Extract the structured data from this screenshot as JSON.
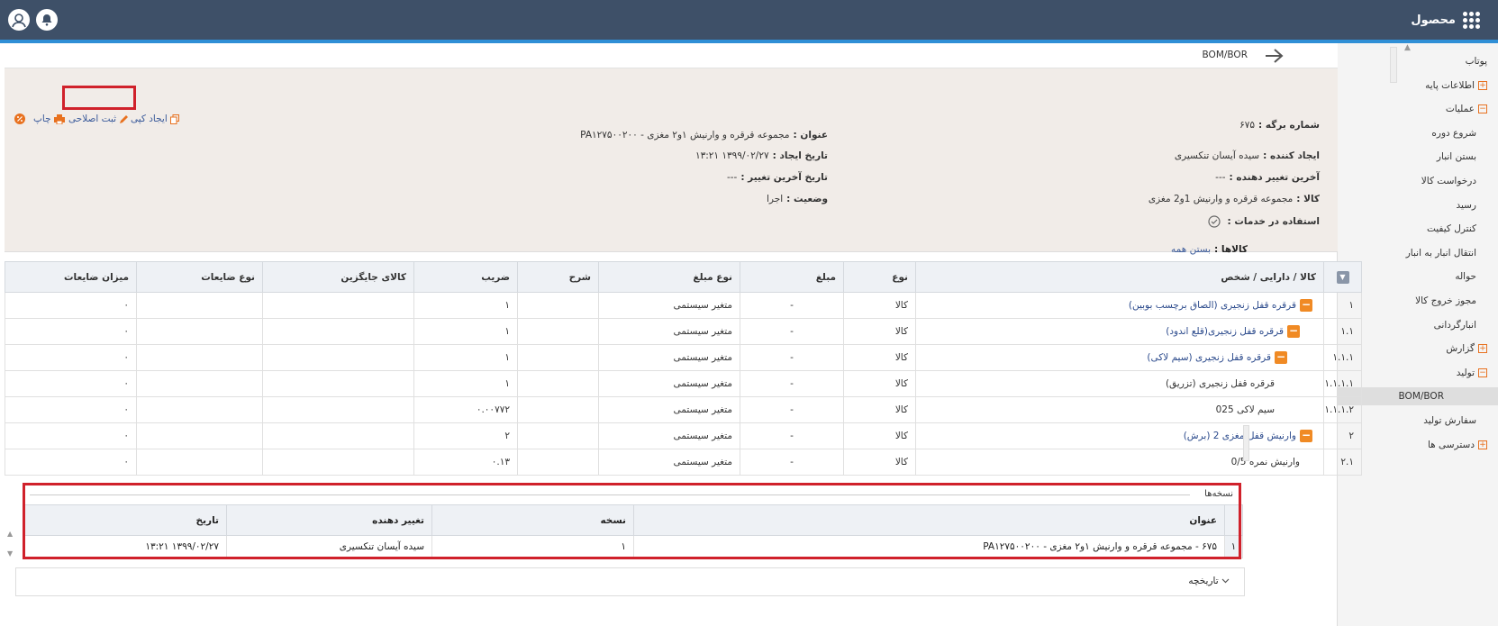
{
  "header": {
    "brand": "محصول"
  },
  "breadcrumb": {
    "title": "BOM/BOR"
  },
  "sidebar": {
    "items": [
      {
        "label": "پوتاب",
        "toggle": "",
        "sub": false
      },
      {
        "label": "اطلاعات پایه",
        "toggle": "+",
        "sub": false
      },
      {
        "label": "عملیات",
        "toggle": "−",
        "sub": false
      },
      {
        "label": "شروع دوره",
        "toggle": "",
        "sub": true
      },
      {
        "label": "بستن انبار",
        "toggle": "",
        "sub": true
      },
      {
        "label": "درخواست کالا",
        "toggle": "",
        "sub": true
      },
      {
        "label": "رسید",
        "toggle": "",
        "sub": true
      },
      {
        "label": "کنترل کیفیت",
        "toggle": "",
        "sub": true
      },
      {
        "label": "انتقال انبار به انبار",
        "toggle": "",
        "sub": true
      },
      {
        "label": "حواله",
        "toggle": "",
        "sub": true
      },
      {
        "label": "مجوز خروج کالا",
        "toggle": "",
        "sub": true
      },
      {
        "label": "انبارگردانی",
        "toggle": "",
        "sub": true
      },
      {
        "label": "گزارش",
        "toggle": "+",
        "sub": false
      },
      {
        "label": "تولید",
        "toggle": "−",
        "sub": false
      },
      {
        "label": "BOM/BOR",
        "toggle": "",
        "sub": true,
        "active": true
      },
      {
        "label": "سفارش تولید",
        "toggle": "",
        "sub": true
      },
      {
        "label": "دسترسی ها",
        "toggle": "+",
        "sub": false
      }
    ]
  },
  "info": {
    "sheet_no_label": "شماره برگه :",
    "sheet_no": "۶۷۵",
    "creator_label": "ایجاد کننده :",
    "creator": "سیده آیسان تنکسیری",
    "last_modifier_label": "آخرین تغییر دهنده :",
    "last_modifier": "---",
    "item_label": "کالا :",
    "item": "مجموعه قرقره و وارنیش 1و2 مغزی",
    "service_label": "استفاده در خدمات :",
    "title_label": "عنوان :",
    "title": "مجموعه قرقره و وارنیش ۱و۲ مغزی - PA۱۲۷۵۰۰۲۰۰",
    "created_label": "تاریخ ایجاد :",
    "created": "۱۳۹۹/۰۲/۲۷ ۱۳:۲۱",
    "modified_label": "تاریخ آخرین تغییر :",
    "modified": "---",
    "status_label": "وضعیت :",
    "status": "اجرا"
  },
  "actions": {
    "copy": "ایجاد کپی",
    "revise": "ثبت اصلاحی",
    "print": "چاپ"
  },
  "goods": {
    "title": "کالاها :",
    "collapse_all": "بستن همه",
    "columns": [
      "",
      "کالا / دارایی / شخص",
      "نوع",
      "مبلغ",
      "نوع مبلغ",
      "شرح",
      "ضریب",
      "کالای جایگزین",
      "نوع ضایعات",
      "میزان ضایعات"
    ],
    "rows": [
      {
        "num": "۱",
        "name": "قرقره قفل زنجیری (الصاق برچسب بوبین)",
        "indent": 0,
        "toggle": true,
        "type": "کالا",
        "amount": "-",
        "amount_type": "متغیر سیستمی",
        "desc": "",
        "factor": "۱",
        "alt": "",
        "waste_type": "",
        "waste": "۰"
      },
      {
        "num": "۱.۱",
        "name": "قرقره قفل زنجیری(قلع اندود)",
        "indent": 1,
        "toggle": true,
        "type": "کالا",
        "amount": "-",
        "amount_type": "متغیر سیستمی",
        "desc": "",
        "factor": "۱",
        "alt": "",
        "waste_type": "",
        "waste": "۰"
      },
      {
        "num": "۱.۱.۱",
        "name": "قرقره قفل زنجیری (سیم لاکی)",
        "indent": 2,
        "toggle": true,
        "type": "کالا",
        "amount": "-",
        "amount_type": "متغیر سیستمی",
        "desc": "",
        "factor": "۱",
        "alt": "",
        "waste_type": "",
        "waste": "۰"
      },
      {
        "num": "۱.۱.۱.۱",
        "name": "قرقره قفل زنجیری (تزریق)",
        "indent": 3,
        "toggle": false,
        "type": "کالا",
        "amount": "-",
        "amount_type": "متغیر سیستمی",
        "desc": "",
        "factor": "۱",
        "alt": "",
        "waste_type": "",
        "waste": "۰"
      },
      {
        "num": "۱.۱.۱.۲",
        "name": "سیم لاکی 025",
        "indent": 3,
        "toggle": false,
        "type": "کالا",
        "amount": "-",
        "amount_type": "متغیر سیستمی",
        "desc": "",
        "factor": "۰.۰۰۷۷۲",
        "alt": "",
        "waste_type": "",
        "waste": "۰"
      },
      {
        "num": "۲",
        "name": "وارنیش قفل مغزی 2 (برش)",
        "indent": 0,
        "toggle": true,
        "type": "کالا",
        "amount": "-",
        "amount_type": "متغیر سیستمی",
        "desc": "",
        "factor": "۲",
        "alt": "",
        "waste_type": "",
        "waste": "۰"
      },
      {
        "num": "۲.۱",
        "name": "وارنیش نمره 0/5",
        "indent": 1,
        "toggle": false,
        "type": "کالا",
        "amount": "-",
        "amount_type": "متغیر سیستمی",
        "desc": "",
        "factor": "۰.۱۳",
        "alt": "",
        "waste_type": "",
        "waste": "۰"
      }
    ]
  },
  "versions": {
    "title": "نسخه‌ها",
    "columns": [
      "",
      "عنوان",
      "نسخه",
      "تغییر دهنده",
      "تاریخ"
    ],
    "rows": [
      {
        "num": "۱",
        "title": "۶۷۵ - مجموعه قرقره و وارنیش ۱و۲ مغزی - PA۱۲۷۵۰۰۲۰۰",
        "version": "۱",
        "modifier": "سیده آیسان تنکسیری",
        "date": "۱۳۹۹/۰۲/۲۷ ۱۳:۲۱"
      }
    ]
  },
  "history": {
    "title": "تاریخچه"
  },
  "colors": {
    "topbar": "#3e5068",
    "accent": "#2f8fd6",
    "highlight": "#d0212b",
    "toggle": "#f08a24"
  }
}
